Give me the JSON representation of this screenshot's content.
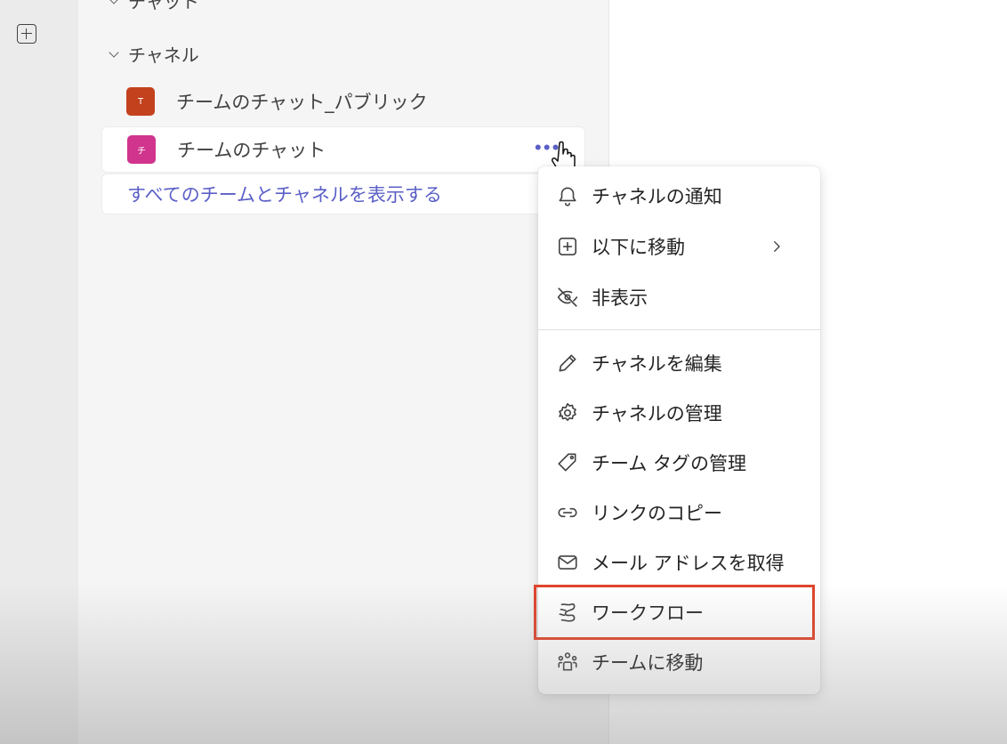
{
  "sidebar": {
    "chat_section_label": "チャット",
    "channel_section_label": "チャネル",
    "channels": [
      {
        "name": "チームのチャット_パブリック",
        "icon_letter": "T",
        "color": "#c4411e"
      },
      {
        "name": "チームのチャット",
        "icon_letter": "チ",
        "color": "#d0348c"
      }
    ],
    "more_options": "•••",
    "show_all_link": "すべてのチームとチャネルを表示する"
  },
  "context_menu": {
    "items": [
      {
        "label": "チャネルの通知",
        "icon": "bell-icon"
      },
      {
        "label": "以下に移動",
        "icon": "plus-square-icon"
      },
      {
        "label": "非表示",
        "icon": "eye-off-icon"
      },
      {
        "label": "チャネルを編集",
        "icon": "pencil-icon"
      },
      {
        "label": "チャネルの管理",
        "icon": "gear-icon"
      },
      {
        "label": "チーム タグの管理",
        "icon": "tag-icon"
      },
      {
        "label": "リンクのコピー",
        "icon": "link-icon"
      },
      {
        "label": "メール アドレスを取得",
        "icon": "mail-icon"
      },
      {
        "label": "ワークフロー",
        "icon": "workflow-icon"
      },
      {
        "label": "チームに移動",
        "icon": "people-team-icon"
      }
    ],
    "highlight_color": "#e0432b",
    "accent_color": "#5b5fc7"
  }
}
